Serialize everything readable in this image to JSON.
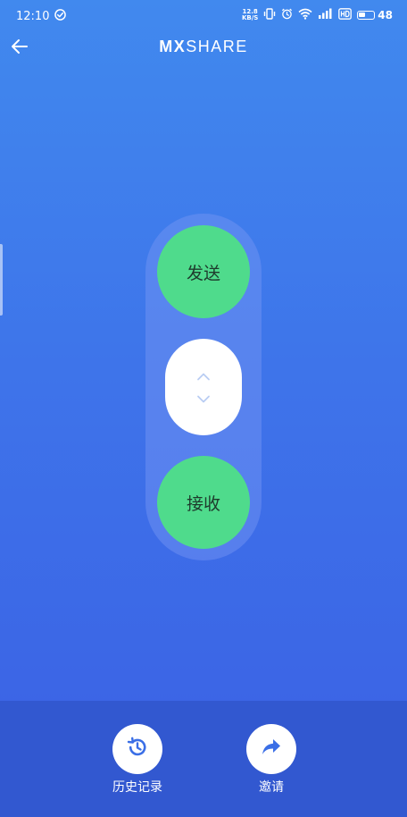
{
  "status_bar": {
    "time": "12:10",
    "net_speed_value": "12.8",
    "net_speed_unit": "KB/S",
    "battery_level": "48",
    "battery_fraction": 0.48
  },
  "app_bar": {
    "logo_bold": "MX",
    "logo_rest": "SHARE",
    "back_icon": "arrow-left-icon"
  },
  "main": {
    "send_label": "发送",
    "receive_label": "接收",
    "toggle_icons": [
      "chevron-up-icon",
      "chevron-down-icon"
    ]
  },
  "bottom_nav": {
    "items": [
      {
        "label": "历史记录",
        "icon": "history-icon"
      },
      {
        "label": "邀请",
        "icon": "share-icon"
      }
    ]
  },
  "colors": {
    "gradient_top": "#4189ee",
    "gradient_bottom": "#3b60e4",
    "accent_green": "#4fdb8c",
    "nav_bar": "#3258d0",
    "icon_blue": "#3b6fe6"
  }
}
